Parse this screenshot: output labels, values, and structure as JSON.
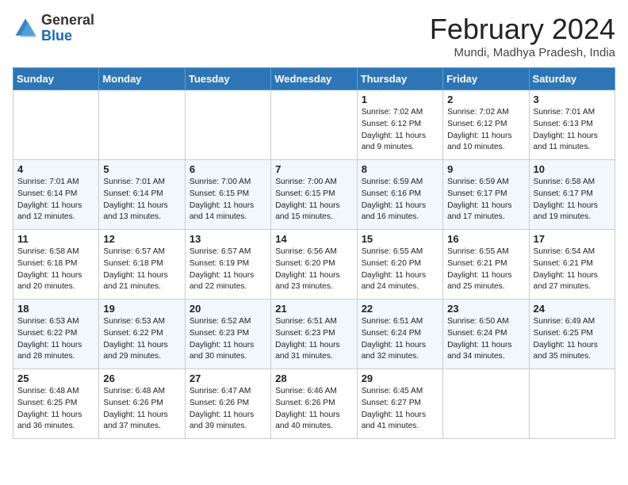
{
  "header": {
    "logo_general": "General",
    "logo_blue": "Blue",
    "month_title": "February 2024",
    "subtitle": "Mundi, Madhya Pradesh, India"
  },
  "weekdays": [
    "Sunday",
    "Monday",
    "Tuesday",
    "Wednesday",
    "Thursday",
    "Friday",
    "Saturday"
  ],
  "rows": [
    [
      {
        "day": "",
        "info": ""
      },
      {
        "day": "",
        "info": ""
      },
      {
        "day": "",
        "info": ""
      },
      {
        "day": "",
        "info": ""
      },
      {
        "day": "1",
        "info": "Sunrise: 7:02 AM\nSunset: 6:12 PM\nDaylight: 11 hours\nand 9 minutes."
      },
      {
        "day": "2",
        "info": "Sunrise: 7:02 AM\nSunset: 6:12 PM\nDaylight: 11 hours\nand 10 minutes."
      },
      {
        "day": "3",
        "info": "Sunrise: 7:01 AM\nSunset: 6:13 PM\nDaylight: 11 hours\nand 11 minutes."
      }
    ],
    [
      {
        "day": "4",
        "info": "Sunrise: 7:01 AM\nSunset: 6:14 PM\nDaylight: 11 hours\nand 12 minutes."
      },
      {
        "day": "5",
        "info": "Sunrise: 7:01 AM\nSunset: 6:14 PM\nDaylight: 11 hours\nand 13 minutes."
      },
      {
        "day": "6",
        "info": "Sunrise: 7:00 AM\nSunset: 6:15 PM\nDaylight: 11 hours\nand 14 minutes."
      },
      {
        "day": "7",
        "info": "Sunrise: 7:00 AM\nSunset: 6:15 PM\nDaylight: 11 hours\nand 15 minutes."
      },
      {
        "day": "8",
        "info": "Sunrise: 6:59 AM\nSunset: 6:16 PM\nDaylight: 11 hours\nand 16 minutes."
      },
      {
        "day": "9",
        "info": "Sunrise: 6:59 AM\nSunset: 6:17 PM\nDaylight: 11 hours\nand 17 minutes."
      },
      {
        "day": "10",
        "info": "Sunrise: 6:58 AM\nSunset: 6:17 PM\nDaylight: 11 hours\nand 19 minutes."
      }
    ],
    [
      {
        "day": "11",
        "info": "Sunrise: 6:58 AM\nSunset: 6:18 PM\nDaylight: 11 hours\nand 20 minutes."
      },
      {
        "day": "12",
        "info": "Sunrise: 6:57 AM\nSunset: 6:18 PM\nDaylight: 11 hours\nand 21 minutes."
      },
      {
        "day": "13",
        "info": "Sunrise: 6:57 AM\nSunset: 6:19 PM\nDaylight: 11 hours\nand 22 minutes."
      },
      {
        "day": "14",
        "info": "Sunrise: 6:56 AM\nSunset: 6:20 PM\nDaylight: 11 hours\nand 23 minutes."
      },
      {
        "day": "15",
        "info": "Sunrise: 6:55 AM\nSunset: 6:20 PM\nDaylight: 11 hours\nand 24 minutes."
      },
      {
        "day": "16",
        "info": "Sunrise: 6:55 AM\nSunset: 6:21 PM\nDaylight: 11 hours\nand 25 minutes."
      },
      {
        "day": "17",
        "info": "Sunrise: 6:54 AM\nSunset: 6:21 PM\nDaylight: 11 hours\nand 27 minutes."
      }
    ],
    [
      {
        "day": "18",
        "info": "Sunrise: 6:53 AM\nSunset: 6:22 PM\nDaylight: 11 hours\nand 28 minutes."
      },
      {
        "day": "19",
        "info": "Sunrise: 6:53 AM\nSunset: 6:22 PM\nDaylight: 11 hours\nand 29 minutes."
      },
      {
        "day": "20",
        "info": "Sunrise: 6:52 AM\nSunset: 6:23 PM\nDaylight: 11 hours\nand 30 minutes."
      },
      {
        "day": "21",
        "info": "Sunrise: 6:51 AM\nSunset: 6:23 PM\nDaylight: 11 hours\nand 31 minutes."
      },
      {
        "day": "22",
        "info": "Sunrise: 6:51 AM\nSunset: 6:24 PM\nDaylight: 11 hours\nand 32 minutes."
      },
      {
        "day": "23",
        "info": "Sunrise: 6:50 AM\nSunset: 6:24 PM\nDaylight: 11 hours\nand 34 minutes."
      },
      {
        "day": "24",
        "info": "Sunrise: 6:49 AM\nSunset: 6:25 PM\nDaylight: 11 hours\nand 35 minutes."
      }
    ],
    [
      {
        "day": "25",
        "info": "Sunrise: 6:48 AM\nSunset: 6:25 PM\nDaylight: 11 hours\nand 36 minutes."
      },
      {
        "day": "26",
        "info": "Sunrise: 6:48 AM\nSunset: 6:26 PM\nDaylight: 11 hours\nand 37 minutes."
      },
      {
        "day": "27",
        "info": "Sunrise: 6:47 AM\nSunset: 6:26 PM\nDaylight: 11 hours\nand 39 minutes."
      },
      {
        "day": "28",
        "info": "Sunrise: 6:46 AM\nSunset: 6:26 PM\nDaylight: 11 hours\nand 40 minutes."
      },
      {
        "day": "29",
        "info": "Sunrise: 6:45 AM\nSunset: 6:27 PM\nDaylight: 11 hours\nand 41 minutes."
      },
      {
        "day": "",
        "info": ""
      },
      {
        "day": "",
        "info": ""
      }
    ]
  ]
}
